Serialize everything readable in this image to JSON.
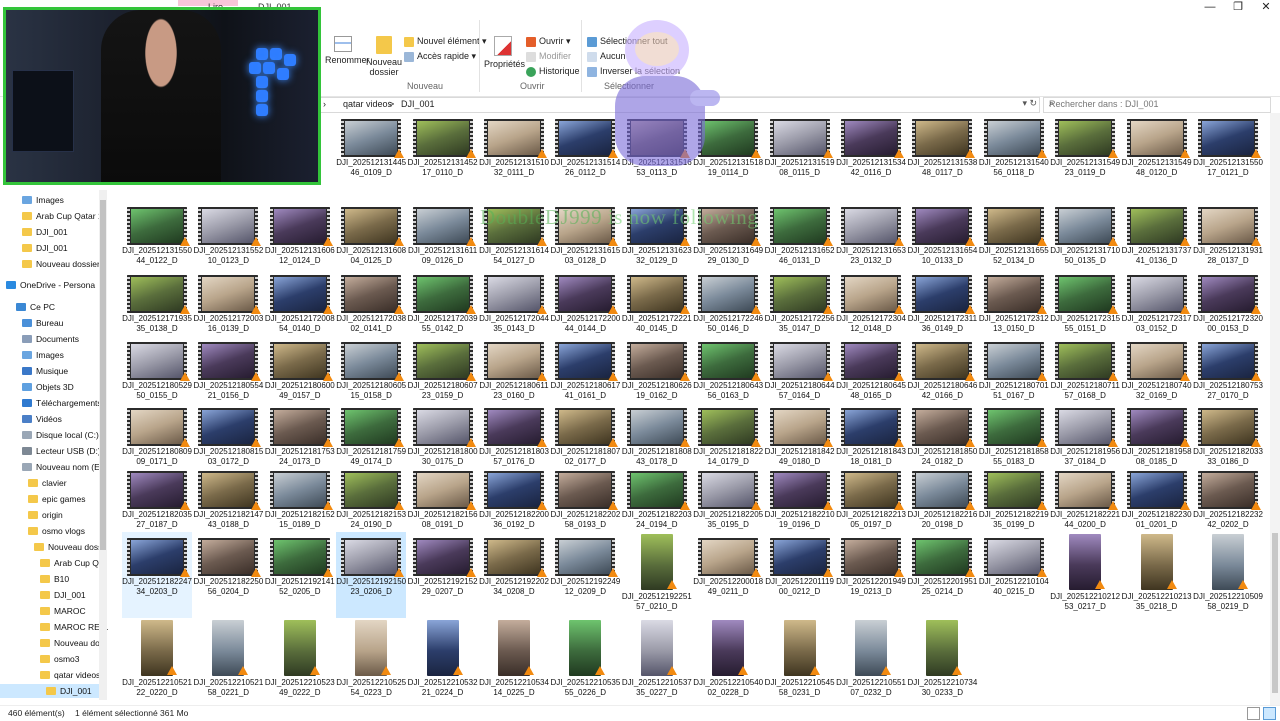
{
  "titlebar": {
    "tab1": "Lire",
    "tab2": "DJI_001",
    "controls": [
      "—",
      "❐",
      "✕"
    ]
  },
  "ribbon": {
    "rename": "Renommer",
    "new_folder": "Nouveau dossier",
    "new_item": "Nouvel élément ▾",
    "easy_access": "Accès rapide ▾",
    "group_new": "Nouveau",
    "properties": "Propriétés",
    "open": "Ouvrir ▾",
    "edit": "Modifier",
    "history": "Historique",
    "group_open": "Ouvrir",
    "select_all": "Sélectionner tout",
    "select_none": "Aucun",
    "invert": "Inverser la sélection",
    "group_select": "Sélectionner"
  },
  "address": {
    "crumb1": "qatar videos",
    "sep": ">",
    "crumb2": "DJI_001",
    "arrow": "›"
  },
  "search": {
    "placeholder": "Rechercher dans : DJI_001"
  },
  "nav": {
    "items": [
      {
        "label": "Images",
        "icon": "images-icon"
      },
      {
        "label": "Arab Cup Qatar 1",
        "icon": "folder-icon"
      },
      {
        "label": "DJI_001",
        "icon": "folder-icon"
      },
      {
        "label": "DJI_001",
        "icon": "folder-icon"
      },
      {
        "label": "Nouveau dossier (",
        "icon": "folder-icon"
      },
      {
        "label": "OneDrive - Persona",
        "icon": "cloud-icon"
      },
      {
        "label": "Ce PC",
        "icon": "pc-icon"
      },
      {
        "label": "Bureau",
        "icon": "desktop-icon"
      },
      {
        "label": "Documents",
        "icon": "documents-icon"
      },
      {
        "label": "Images",
        "icon": "images-icon"
      },
      {
        "label": "Musique",
        "icon": "music-icon"
      },
      {
        "label": "Objets 3D",
        "icon": "3d-icon"
      },
      {
        "label": "Téléchargements",
        "icon": "download-icon"
      },
      {
        "label": "Vidéos",
        "icon": "videos-icon"
      },
      {
        "label": "Disque local (C:)",
        "icon": "drive-icon"
      },
      {
        "label": "Lecteur USB (D:)",
        "icon": "usb-icon"
      },
      {
        "label": "Nouveau nom (E:",
        "icon": "drive-icon"
      },
      {
        "label": "clavier",
        "icon": "folder-icon"
      },
      {
        "label": "epic games",
        "icon": "folder-icon"
      },
      {
        "label": "origin",
        "icon": "folder-icon"
      },
      {
        "label": "osmo vlogs",
        "icon": "folder-icon"
      },
      {
        "label": "Nouveau dossi",
        "icon": "folder-icon"
      },
      {
        "label": "Arab Cup Qa",
        "icon": "folder-icon"
      },
      {
        "label": "B10",
        "icon": "folder-icon"
      },
      {
        "label": "DJI_001",
        "icon": "folder-icon"
      },
      {
        "label": "MAROC",
        "icon": "folder-icon"
      },
      {
        "label": "MAROC REEL",
        "icon": "folder-icon"
      },
      {
        "label": "Nouveau dos",
        "icon": "folder-icon"
      },
      {
        "label": "osmo3",
        "icon": "folder-icon"
      },
      {
        "label": "qatar videos",
        "icon": "folder-icon"
      },
      {
        "label": "DJI_001",
        "icon": "folder-icon"
      }
    ]
  },
  "status": {
    "count": "460 élément(s)",
    "selected": "1 élément sélectionné  361 Mo"
  },
  "overlay": {
    "follow_name": "DoubleDJ999",
    "follow_text": "is now following"
  },
  "files": [
    [
      "DJI_20251213144546_0109_D",
      "DJI_20251213145217_0110_D",
      "DJI_20251213151032_0111_D",
      "DJI_20251213151426_0112_D",
      "DJI_20251213151653_0113_D",
      "DJI_20251213151819_0114_D",
      "DJI_20251213151908_0115_D",
      "DJI_20251213153442_0116_D",
      "DJI_20251213153848_0117_D",
      "DJI_20251213154056_0118_D",
      "DJI_20251213154923_0119_D",
      "DJI_20251213154948_0120_D",
      "DJI_20251213155017_0121_D"
    ],
    [
      "DJI_20251213155044_0122_D",
      "DJI_20251213155210_0123_D",
      "DJI_20251213160612_0124_D",
      "DJI_20251213160804_0125_D",
      "DJI_20251213161109_0126_D",
      "DJI_20251213161454_0127_D",
      "DJI_20251213161503_0128_D",
      "DJI_20251213162332_0129_D",
      "DJI_20251213164929_0130_D",
      "DJI_20251213165246_0131_D",
      "DJI_20251213165323_0132_D",
      "DJI_20251213165410_0133_D",
      "DJI_20251213165552_0134_D",
      "DJI_20251213171050_0135_D",
      "DJI_20251213173741_0136_D",
      "DJI_20251213193128_0137_D"
    ],
    [
      "DJI_20251217193535_0138_D",
      "DJI_20251217200316_0139_D",
      "DJI_20251217200854_0140_D",
      "DJI_20251217203802_0141_D",
      "DJI_20251217203955_0142_D",
      "DJI_20251217204435_0143_D",
      "DJI_20251217220044_0144_D",
      "DJI_20251217222140_0145_D",
      "DJI_20251217224650_0146_D",
      "DJI_20251217225635_0147_D",
      "DJI_20251217230412_0148_D",
      "DJI_20251217231136_0149_D",
      "DJI_20251217231213_0150_D",
      "DJI_20251217231555_0151_D",
      "DJI_20251217231703_0152_D",
      "DJI_20251217232000_0153_D"
    ],
    [
      "DJI_20251218052950_0155_D",
      "DJI_20251218055421_0156_D",
      "DJI_20251218060049_0157_D",
      "DJI_20251218060515_0158_D",
      "DJI_20251218060723_0159_D",
      "DJI_20251218061123_0160_D",
      "DJI_20251218061741_0161_D",
      "DJI_20251218062619_0162_D",
      "DJI_20251218064356_0163_D",
      "DJI_20251218064457_0164_D",
      "DJI_20251218064548_0165_D",
      "DJI_20251218064642_0166_D",
      "DJI_20251218070151_0167_D",
      "DJI_20251218071157_0168_D",
      "DJI_20251218074032_0169_D",
      "DJI_20251218075327_0170_D"
    ],
    [
      "DJI_20251218080909_0171_D",
      "DJI_20251218081503_0172_D",
      "DJI_20251218175324_0173_D",
      "DJI_20251218175949_0174_D",
      "DJI_20251218180030_0175_D",
      "DJI_20251218180357_0176_D",
      "DJI_20251218180702_0177_D",
      "DJI_20251218180843_0178_D",
      "DJI_20251218182214_0179_D",
      "DJI_20251218184249_0180_D",
      "DJI_20251218184318_0181_D",
      "DJI_20251218185024_0182_D",
      "DJI_20251218185855_0183_D",
      "DJI_20251218195637_0184_D",
      "DJI_20251218195808_0185_D",
      "DJI_20251218203333_0186_D"
    ],
    [
      "DJI_20251218203527_0187_D",
      "DJI_20251218214743_0188_D",
      "DJI_20251218215215_0189_D",
      "DJI_20251218215324_0190_D",
      "DJI_20251218215608_0191_D",
      "DJI_20251218220036_0192_D",
      "DJI_20251218220258_0193_D",
      "DJI_20251218220324_0194_D",
      "DJI_20251218220535_0195_D",
      "DJI_20251218221019_0196_D",
      "DJI_20251218221305_0197_D",
      "DJI_20251218221620_0198_D",
      "DJI_20251218221935_0199_D",
      "DJI_20251218222144_0200_D",
      "DJI_20251218223001_0201_D",
      "DJI_20251218223242_0202_D"
    ],
    [
      "DJI_20251218224734_0203_D",
      "DJI_20251218225056_0204_D",
      "DJI_20251219214152_0205_D",
      "DJI_20251219215023_0206_D",
      "DJI_20251219215229_0207_D",
      "DJI_20251219220234_0208_D",
      "DJI_20251219224912_0209_D",
      "DJI_20251219225157_0210_D",
      "DJI_20251220001849_0211_D",
      "DJI_20251220111900_0212_D",
      "DJI_20251220194919_0213_D",
      "DJI_20251220195125_0214_D",
      "DJI_20251221010440_0215_D",
      "DJI_20251221021253_0217_D",
      "DJI_20251221021335_0218_D",
      "DJI_20251221050958_0219_D"
    ],
    [
      "DJI_20251221052122_0220_D",
      "DJI_20251221052158_0221_D",
      "DJI_20251221052349_0222_D",
      "DJI_20251221052554_0223_D",
      "DJI_20251221053221_0224_D",
      "DJI_20251221053414_0225_D",
      "DJI_20251221053555_0226_D",
      "DJI_20251221053735_0227_D",
      "DJI_20251221054002_0228_D",
      "DJI_20251221054558_0231_D",
      "DJI_20251221055107_0232_D",
      "DJI_20251221073430_0233_D"
    ]
  ],
  "colors": {
    "selection": "#cce8ff",
    "accent": "#0078d7",
    "cam_border": "#33c43a",
    "vlc": "#f28a10"
  }
}
